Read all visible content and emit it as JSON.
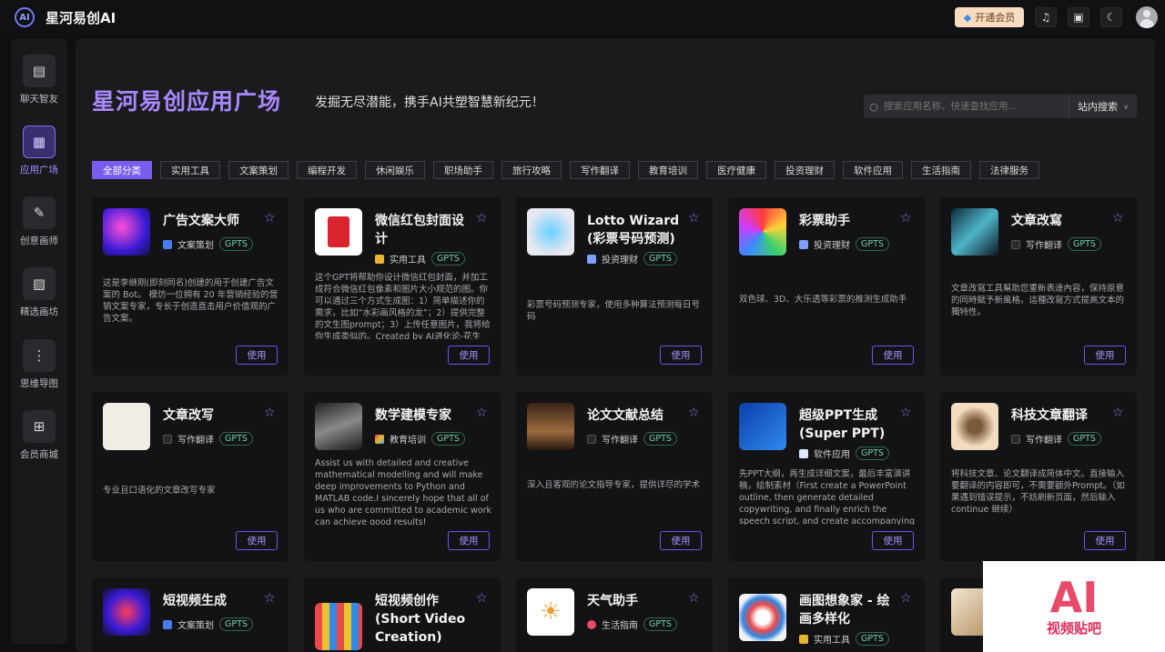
{
  "app": {
    "title": "星河易创AI",
    "logo_icon": "ai-logo-icon"
  },
  "topbar": {
    "vip_label": "开通会员",
    "icons": [
      "bell-icon",
      "gift-icon",
      "moon-icon"
    ]
  },
  "sidebar": {
    "items": [
      {
        "label": "聊天智友",
        "icon": "chat-icon"
      },
      {
        "label": "应用广场",
        "icon": "grid-icon",
        "active": true
      },
      {
        "label": "创意画师",
        "icon": "paint-icon"
      },
      {
        "label": "精选画坊",
        "icon": "image-icon"
      },
      {
        "label": "思维导图",
        "icon": "mindmap-icon"
      },
      {
        "label": "会员商城",
        "icon": "cart-icon"
      }
    ]
  },
  "hero": {
    "title": "星河易创应用广场",
    "subtitle": "发掘无尽潜能，携手AI共塑智慧新纪元！"
  },
  "search": {
    "placeholder": "搜索应用名称、快速查找应用...",
    "scope": "站内搜索"
  },
  "categories": [
    "全部分类",
    "实用工具",
    "文案策划",
    "编程开发",
    "休闲娱乐",
    "职场助手",
    "旅行攻略",
    "写作翻译",
    "教育培训",
    "医疗健康",
    "投资理财",
    "软件应用",
    "生活指南",
    "法律服务"
  ],
  "gpts_badge": "GPTS",
  "use_label": "使用",
  "cards": [
    {
      "title": "广告文案大师",
      "category": "文案策划",
      "desc": "这是李继刚(即刻同名)创建的用于创建广告文案的 Bot。 模仿一位拥有 20 年营销经验的营销文案专家，专长于创造直击用户价值观的广告文案。"
    },
    {
      "title": "微信红包封面设计",
      "category": "实用工具",
      "desc": "这个GPT将帮助你设计微信红包封面，并加工成符合微信红包像素和图片大小规范的图。你可以通过三个方式生成图：1）简单描述你的需求，比如“水彩画风格的龙”；2）提供完整的文生图prompt；3）上传任意图片，我将给你生成类似的。Created by AI进化论-花生"
    },
    {
      "title": "Lotto Wizard (彩票号码预测)",
      "category": "投资理财",
      "desc": "彩票号码预测专家，使用多种算法预测每日号码"
    },
    {
      "title": "彩票助手",
      "category": "投资理财",
      "desc": "双色球、3D、大乐透等彩票的推测生成助手"
    },
    {
      "title": "文章改寫",
      "category": "写作翻译",
      "desc": "文章改寫工具幫助您重新表達內容，保持原意的同時賦予新風格。這種改寫方式提高文本的獨特性。"
    },
    {
      "title": "文章改写",
      "category": "写作翻译",
      "desc": "专业且口语化的文章改写专家"
    },
    {
      "title": "数学建模专家",
      "category": "教育培训",
      "desc": "Assist us with detailed and creative mathematical modelling and will make deep improvements to Python and MATLAB code.I sincerely hope that all of us who are committed to academic work can achieve good results!"
    },
    {
      "title": "论文文献总结",
      "category": "写作翻译",
      "desc": "深入且客观的论文指导专家，提供详尽的学术分析"
    },
    {
      "title": "超级PPT生成 (Super PPT)",
      "category": "软件应用",
      "desc": "先PPT大纲，再生成详细文案，最后丰富演讲稿，绘制素材（First create a PowerPoint outline, then generate detailed copywriting, and finally enrich the speech script, and create accompanying visual materials.）"
    },
    {
      "title": "科技文章翻译",
      "category": "写作翻译",
      "desc": "将科技文章、论文翻译成简体中文。直接输入要翻译的内容即可，不需要额外Prompt。（如果遇到错误提示，不妨刷新页面，然后输入 continue 继续）"
    },
    {
      "title": "短视频生成",
      "category": "文案策划",
      "desc": ""
    },
    {
      "title": "短视频创作(Short Video Creation)",
      "category": "",
      "desc": ""
    },
    {
      "title": "天气助手",
      "category": "生活指南",
      "desc": ""
    },
    {
      "title": "画图想象家 - 绘画多样化",
      "category": "实用工具",
      "desc": ""
    },
    {
      "title": "",
      "category": "",
      "desc": ""
    }
  ],
  "watermark": {
    "line1": "AI",
    "line2": "视频贴吧"
  }
}
